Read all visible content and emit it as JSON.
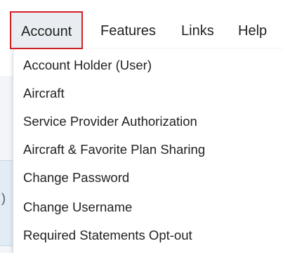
{
  "menubar": {
    "items": [
      {
        "label": "Account"
      },
      {
        "label": "Features"
      },
      {
        "label": "Links"
      },
      {
        "label": "Help"
      }
    ]
  },
  "dropdown": {
    "items": [
      {
        "label": "Account Holder (User)"
      },
      {
        "label": "Aircraft"
      },
      {
        "label": "Service Provider Authorization"
      },
      {
        "label": "Aircraft & Favorite Plan Sharing"
      },
      {
        "label": "Change Password"
      },
      {
        "label": "Change Username"
      },
      {
        "label": "Required Statements Opt-out"
      }
    ]
  },
  "background": {
    "fragment_text": ")"
  },
  "colors": {
    "highlight_border": "#d32027",
    "active_background": "#e9edf1"
  }
}
